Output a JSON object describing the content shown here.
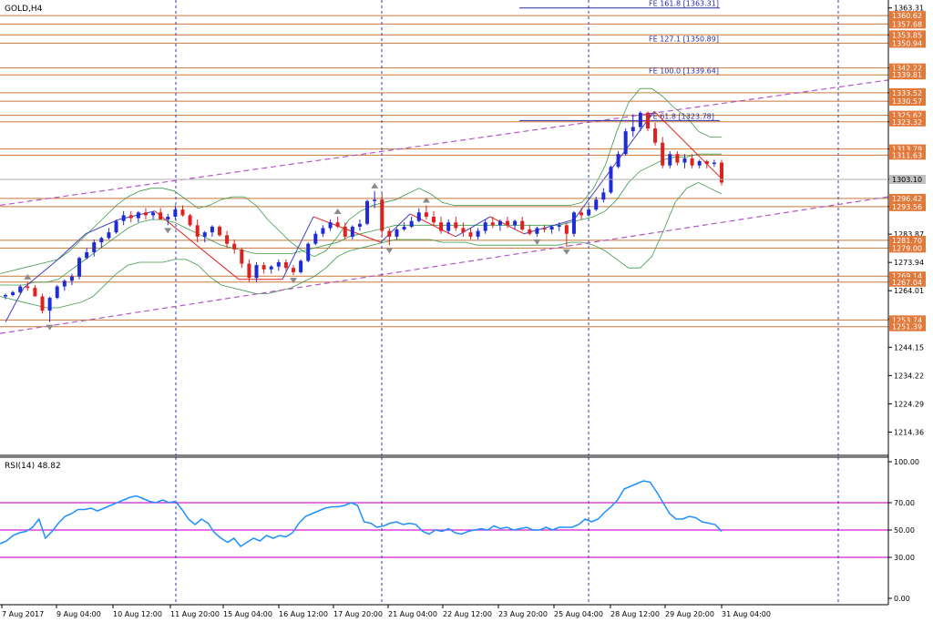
{
  "chart_data": [
    {
      "type": "candlestick",
      "title": "GOLD,H4",
      "ylim": [
        1206.2,
        1366.1
      ],
      "price_ticks": [
        1363.31,
        1353.85,
        1342.22,
        1333.52,
        1323.32,
        1313.79,
        1303.1,
        1293.56,
        1283.87,
        1273.94,
        1264.01,
        1254.08,
        1244.15,
        1234.22,
        1224.29,
        1214.36
      ],
      "x_labels": [
        "7 Aug 2017",
        "9 Aug 04:00",
        "10 Aug 12:00",
        "11 Aug 20:00",
        "15 Aug 04:00",
        "16 Aug 12:00",
        "17 Aug 20:00",
        "21 Aug 04:00",
        "22 Aug 12:00",
        "23 Aug 20:00",
        "25 Aug 04:00",
        "28 Aug 12:00",
        "29 Aug 20:00",
        "31 Aug 04:00"
      ],
      "current_price": 1303.1,
      "horizontal_levels": [
        1360.62,
        1357.68,
        1353.85,
        1350.94,
        1342.22,
        1339.81,
        1333.52,
        1330.57,
        1325.62,
        1323.32,
        1313.79,
        1311.63,
        1296.42,
        1293.56,
        1281.7,
        1279.0,
        1269.14,
        1267.04,
        1253.74,
        1251.39
      ],
      "fibo_expansions": [
        {
          "label": "FE 161.8 [1363.31]",
          "value": 1363.31
        },
        {
          "label": "FE 127.1 [1350.89]",
          "value": 1350.89
        },
        {
          "label": "FE 100.0 [1339.64]",
          "value": 1339.64
        },
        {
          "label": "FE 61.8 [1323.78]",
          "value": 1323.78
        }
      ],
      "candles": [
        [
          1262.0,
          1263.0,
          1261.0,
          1262.5
        ],
        [
          1262.5,
          1264.0,
          1262.0,
          1263.5
        ],
        [
          1263.5,
          1266.0,
          1263.0,
          1265.5
        ],
        [
          1265.5,
          1267.0,
          1264.0,
          1265.0
        ],
        [
          1265.0,
          1266.0,
          1262.0,
          1262.0
        ],
        [
          1262.0,
          1263.0,
          1256.0,
          1257.0
        ],
        [
          1257.0,
          1262.0,
          1253.0,
          1261.5
        ],
        [
          1261.5,
          1266.0,
          1261.0,
          1265.5
        ],
        [
          1265.5,
          1268.0,
          1264.0,
          1267.5
        ],
        [
          1267.5,
          1270.0,
          1266.0,
          1269.0
        ],
        [
          1269.0,
          1276.0,
          1268.0,
          1275.5
        ],
        [
          1275.5,
          1279.0,
          1275.0,
          1277.5
        ],
        [
          1277.5,
          1282.0,
          1276.0,
          1281.0
        ],
        [
          1281.0,
          1283.0,
          1279.0,
          1282.5
        ],
        [
          1282.5,
          1286.0,
          1282.0,
          1284.5
        ],
        [
          1284.5,
          1289.0,
          1284.0,
          1288.5
        ],
        [
          1288.5,
          1292.0,
          1287.0,
          1290.5
        ],
        [
          1290.5,
          1292.0,
          1288.0,
          1289.5
        ],
        [
          1289.5,
          1292.0,
          1288.0,
          1291.5
        ],
        [
          1291.5,
          1293.0,
          1289.0,
          1290.5
        ],
        [
          1290.5,
          1292.0,
          1289.0,
          1291.5
        ],
        [
          1291.5,
          1293.0,
          1289.0,
          1289.0
        ],
        [
          1289.0,
          1291.0,
          1287.0,
          1290.0
        ],
        [
          1290.0,
          1294.0,
          1289.0,
          1292.5
        ],
        [
          1292.5,
          1294.0,
          1290.0,
          1290.5
        ],
        [
          1290.5,
          1291.0,
          1286.5,
          1287.0
        ],
        [
          1287.0,
          1289.0,
          1281.0,
          1283.0
        ],
        [
          1283.0,
          1285.0,
          1281.0,
          1284.5
        ],
        [
          1284.5,
          1287.0,
          1283.0,
          1286.5
        ],
        [
          1286.5,
          1287.0,
          1283.0,
          1283.5
        ],
        [
          1283.5,
          1285.0,
          1279.0,
          1280.5
        ],
        [
          1280.5,
          1282.0,
          1277.0,
          1278.5
        ],
        [
          1278.5,
          1279.0,
          1272.0,
          1273.5
        ],
        [
          1273.5,
          1275.0,
          1267.0,
          1268.5
        ],
        [
          1268.5,
          1274.0,
          1267.0,
          1273.0
        ],
        [
          1273.0,
          1274.0,
          1270.0,
          1271.5
        ],
        [
          1271.5,
          1273.0,
          1270.0,
          1272.5
        ],
        [
          1272.5,
          1275.0,
          1271.0,
          1274.0
        ],
        [
          1274.0,
          1275.0,
          1271.0,
          1272.0
        ],
        [
          1272.0,
          1273.0,
          1269.5,
          1270.5
        ],
        [
          1270.5,
          1275.0,
          1270.0,
          1274.5
        ],
        [
          1274.5,
          1281.0,
          1274.0,
          1280.5
        ],
        [
          1280.5,
          1285.0,
          1280.0,
          1284.0
        ],
        [
          1284.0,
          1287.0,
          1283.0,
          1286.0
        ],
        [
          1286.0,
          1289.0,
          1285.0,
          1288.0
        ],
        [
          1288.0,
          1290.0,
          1286.0,
          1286.5
        ],
        [
          1286.5,
          1288.0,
          1282.0,
          1283.0
        ],
        [
          1283.0,
          1287.0,
          1282.0,
          1286.5
        ],
        [
          1286.5,
          1289.0,
          1285.0,
          1287.5
        ],
        [
          1287.5,
          1296.0,
          1287.0,
          1295.5
        ],
        [
          1295.5,
          1299.0,
          1293.0,
          1296.0
        ],
        [
          1296.0,
          1298.0,
          1283.0,
          1285.0
        ],
        [
          1285.0,
          1286.0,
          1280.0,
          1283.0
        ],
        [
          1283.0,
          1286.0,
          1282.0,
          1285.5
        ],
        [
          1285.5,
          1288.0,
          1285.0,
          1286.5
        ],
        [
          1286.5,
          1290.0,
          1286.0,
          1288.5
        ],
        [
          1288.5,
          1293.0,
          1288.0,
          1291.5
        ],
        [
          1291.5,
          1294.0,
          1289.0,
          1290.0
        ],
        [
          1290.0,
          1292.0,
          1287.0,
          1288.0
        ],
        [
          1288.0,
          1290.0,
          1284.0,
          1285.0
        ],
        [
          1285.0,
          1289.0,
          1284.0,
          1288.0
        ],
        [
          1288.0,
          1290.0,
          1285.0,
          1286.0
        ],
        [
          1286.0,
          1288.0,
          1283.0,
          1284.5
        ],
        [
          1284.5,
          1286.0,
          1282.0,
          1283.0
        ],
        [
          1283.0,
          1286.0,
          1282.0,
          1285.0
        ],
        [
          1285.0,
          1289.0,
          1284.0,
          1288.0
        ],
        [
          1288.0,
          1290.0,
          1286.0,
          1287.0
        ],
        [
          1287.0,
          1289.0,
          1285.0,
          1288.5
        ],
        [
          1288.5,
          1290.0,
          1286.0,
          1287.0
        ],
        [
          1287.0,
          1289.0,
          1285.5,
          1288.5
        ],
        [
          1288.5,
          1290.0,
          1285.0,
          1285.5
        ],
        [
          1285.5,
          1287.0,
          1283.5,
          1284.0
        ],
        [
          1284.0,
          1286.5,
          1283.0,
          1286.0
        ],
        [
          1286.0,
          1287.0,
          1284.5,
          1285.5
        ],
        [
          1285.5,
          1287.0,
          1284.0,
          1286.5
        ],
        [
          1286.5,
          1288.0,
          1285.0,
          1287.0
        ],
        [
          1287.0,
          1288.0,
          1279.5,
          1284.0
        ],
        [
          1284.0,
          1292.0,
          1283.0,
          1291.5
        ],
        [
          1291.5,
          1293.0,
          1289.0,
          1290.5
        ],
        [
          1290.5,
          1294.0,
          1290.0,
          1292.5
        ],
        [
          1292.5,
          1297.0,
          1292.0,
          1296.0
        ],
        [
          1296.0,
          1300.0,
          1295.0,
          1298.5
        ],
        [
          1298.5,
          1308.0,
          1298.0,
          1307.5
        ],
        [
          1307.5,
          1313.0,
          1307.0,
          1312.0
        ],
        [
          1312.0,
          1321.0,
          1311.5,
          1320.0
        ],
        [
          1320.0,
          1326.0,
          1318.0,
          1321.5
        ],
        [
          1321.5,
          1327.0,
          1320.0,
          1326.5
        ],
        [
          1326.5,
          1327.0,
          1320.0,
          1321.0
        ],
        [
          1321.0,
          1323.0,
          1315.0,
          1316.0
        ],
        [
          1316.0,
          1318.0,
          1307.0,
          1308.0
        ],
        [
          1308.0,
          1313.0,
          1307.0,
          1312.0
        ],
        [
          1312.0,
          1313.0,
          1308.0,
          1309.0
        ],
        [
          1309.0,
          1312.0,
          1307.0,
          1310.5
        ],
        [
          1310.5,
          1312.0,
          1307.0,
          1308.0
        ],
        [
          1308.0,
          1310.0,
          1307.0,
          1309.5
        ],
        [
          1309.5,
          1310.0,
          1307.0,
          1308.5
        ],
        [
          1308.5,
          1310.0,
          1307.5,
          1309.0
        ],
        [
          1309.0,
          1310.0,
          1301.0,
          1302.0
        ]
      ],
      "bollinger": {
        "upper": [
          1270,
          1271,
          1272,
          1273,
          1274,
          1275,
          1278,
          1282,
          1286,
          1290,
          1294,
          1297,
          1299,
          1300,
          1300,
          1299,
          1296,
          1293,
          1294,
          1296,
          1297,
          1297,
          1294,
          1289,
          1285,
          1281,
          1278,
          1276,
          1278,
          1283,
          1289,
          1292,
          1294,
          1295,
          1296,
          1298,
          1300,
          1298,
          1295,
          1294,
          1294,
          1294,
          1294,
          1294,
          1294,
          1294,
          1294,
          1294,
          1294,
          1294,
          1295,
          1300,
          1308,
          1320,
          1330,
          1335,
          1335,
          1332,
          1328,
          1325,
          1320,
          1318,
          1318
        ],
        "mid": [
          1266,
          1266,
          1266,
          1267,
          1267,
          1268,
          1271,
          1274,
          1277,
          1280,
          1283,
          1286,
          1288,
          1289,
          1289,
          1288,
          1286,
          1284,
          1282,
          1280,
          1279,
          1278,
          1277,
          1277,
          1277,
          1277,
          1278,
          1279,
          1280,
          1281,
          1283,
          1284,
          1285,
          1286,
          1287,
          1287,
          1287,
          1287,
          1287,
          1287,
          1287,
          1287,
          1287,
          1287,
          1287,
          1287,
          1287,
          1287,
          1287,
          1288,
          1289,
          1290,
          1292,
          1296,
          1302,
          1306,
          1308,
          1310,
          1311,
          1311,
          1312,
          1312,
          1312
        ],
        "lower": [
          1262,
          1261,
          1260,
          1259,
          1258,
          1258,
          1259,
          1260,
          1262,
          1266,
          1270,
          1273,
          1274,
          1274,
          1274,
          1275,
          1275,
          1273,
          1269,
          1266,
          1265,
          1264,
          1263,
          1263,
          1264,
          1265,
          1267,
          1269,
          1272,
          1276,
          1278,
          1279,
          1280,
          1281,
          1282,
          1282,
          1282,
          1282,
          1281,
          1281,
          1281,
          1280,
          1280,
          1280,
          1280,
          1280,
          1280,
          1280,
          1280,
          1281,
          1281,
          1280,
          1278,
          1275,
          1272,
          1272,
          1276,
          1285,
          1295,
          1300,
          1302,
          1300,
          1298
        ]
      }
    },
    {
      "type": "line",
      "title": "RSI(14) 48.82",
      "ylim": [
        0,
        100
      ],
      "y_ticks": [
        100.0,
        70.0,
        50.0,
        30.0,
        0.0
      ],
      "levels": [
        70,
        50,
        30
      ],
      "series": [
        {
          "name": "RSI(14)",
          "values": [
            40,
            42,
            46,
            48,
            49,
            52,
            58,
            44,
            49,
            55,
            60,
            62,
            65,
            65,
            66,
            64,
            66,
            68,
            70,
            72,
            74,
            75,
            73,
            71,
            70,
            72,
            70,
            71,
            65,
            58,
            54,
            58,
            55,
            48,
            44,
            41,
            44,
            38,
            41,
            44,
            42,
            46,
            44,
            46,
            45,
            48,
            55,
            60,
            62,
            64,
            66,
            67,
            67,
            68,
            70,
            68,
            56,
            55,
            52,
            53,
            55,
            56,
            54,
            55,
            54,
            49,
            47,
            50,
            49,
            51,
            48,
            47,
            49,
            50,
            51,
            50,
            53,
            51,
            52,
            50,
            51,
            52,
            50,
            50,
            52,
            50,
            52,
            52,
            52,
            54,
            58,
            56,
            58,
            63,
            67,
            72,
            80,
            82,
            84,
            86,
            85,
            78,
            70,
            62,
            58,
            58,
            60,
            59,
            56,
            55,
            54,
            49
          ]
        }
      ]
    }
  ],
  "labels": {
    "symbol": "GOLD,H4",
    "rsi": "RSI(14) 48.82",
    "current_price": "1303.10"
  },
  "colors": {
    "bull": "#1e2bd6",
    "bear": "#e0201f",
    "level": "#c8783a",
    "level_label_bg": "#e0793a",
    "bollinger": "#3a9a4a",
    "channel": "#b455c8",
    "zigzag": "#e02020",
    "rsi_line": "#1e90ff",
    "rsi_level": "#d41ed4",
    "grid_vertical": "#3a3aaa",
    "fibo": "#2a2aa0"
  }
}
